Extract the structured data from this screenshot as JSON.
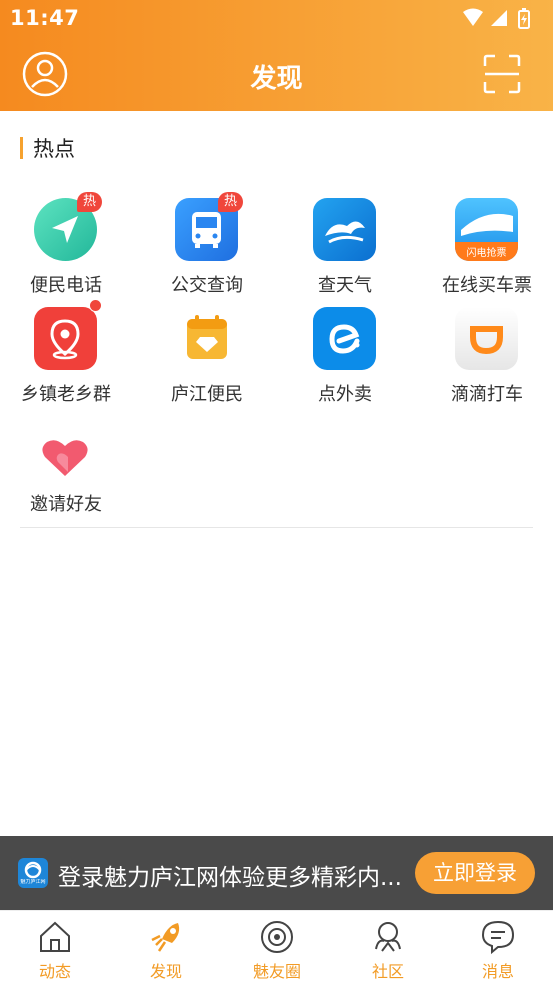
{
  "status": {
    "time": "11:47"
  },
  "header": {
    "title": "发现"
  },
  "section": {
    "title": "热点"
  },
  "grid": [
    {
      "label": "便民电话",
      "badge": "热"
    },
    {
      "label": "公交查询",
      "badge": "热"
    },
    {
      "label": "查天气"
    },
    {
      "label": "在线买车票",
      "icon_text": "闪电抢票"
    },
    {
      "label": "乡镇老乡群"
    },
    {
      "label": "庐江便民"
    },
    {
      "label": "点外卖"
    },
    {
      "label": "滴滴打车"
    },
    {
      "label": "邀请好友"
    }
  ],
  "banner": {
    "logo_text": "魅力庐江网",
    "text": "登录魅力庐江网体验更多精彩内...",
    "button": "立即登录"
  },
  "tabs": [
    {
      "label": "动态",
      "icon": "home-icon"
    },
    {
      "label": "发现",
      "icon": "rocket-icon",
      "active": true
    },
    {
      "label": "魅友圈",
      "icon": "camera-icon"
    },
    {
      "label": "社区",
      "icon": "community-icon"
    },
    {
      "label": "消息",
      "icon": "message-icon"
    }
  ],
  "colors": {
    "accent": "#f29b25",
    "header_start": "#f58a1f",
    "header_end": "#f9b347",
    "badge": "#f0463b"
  }
}
